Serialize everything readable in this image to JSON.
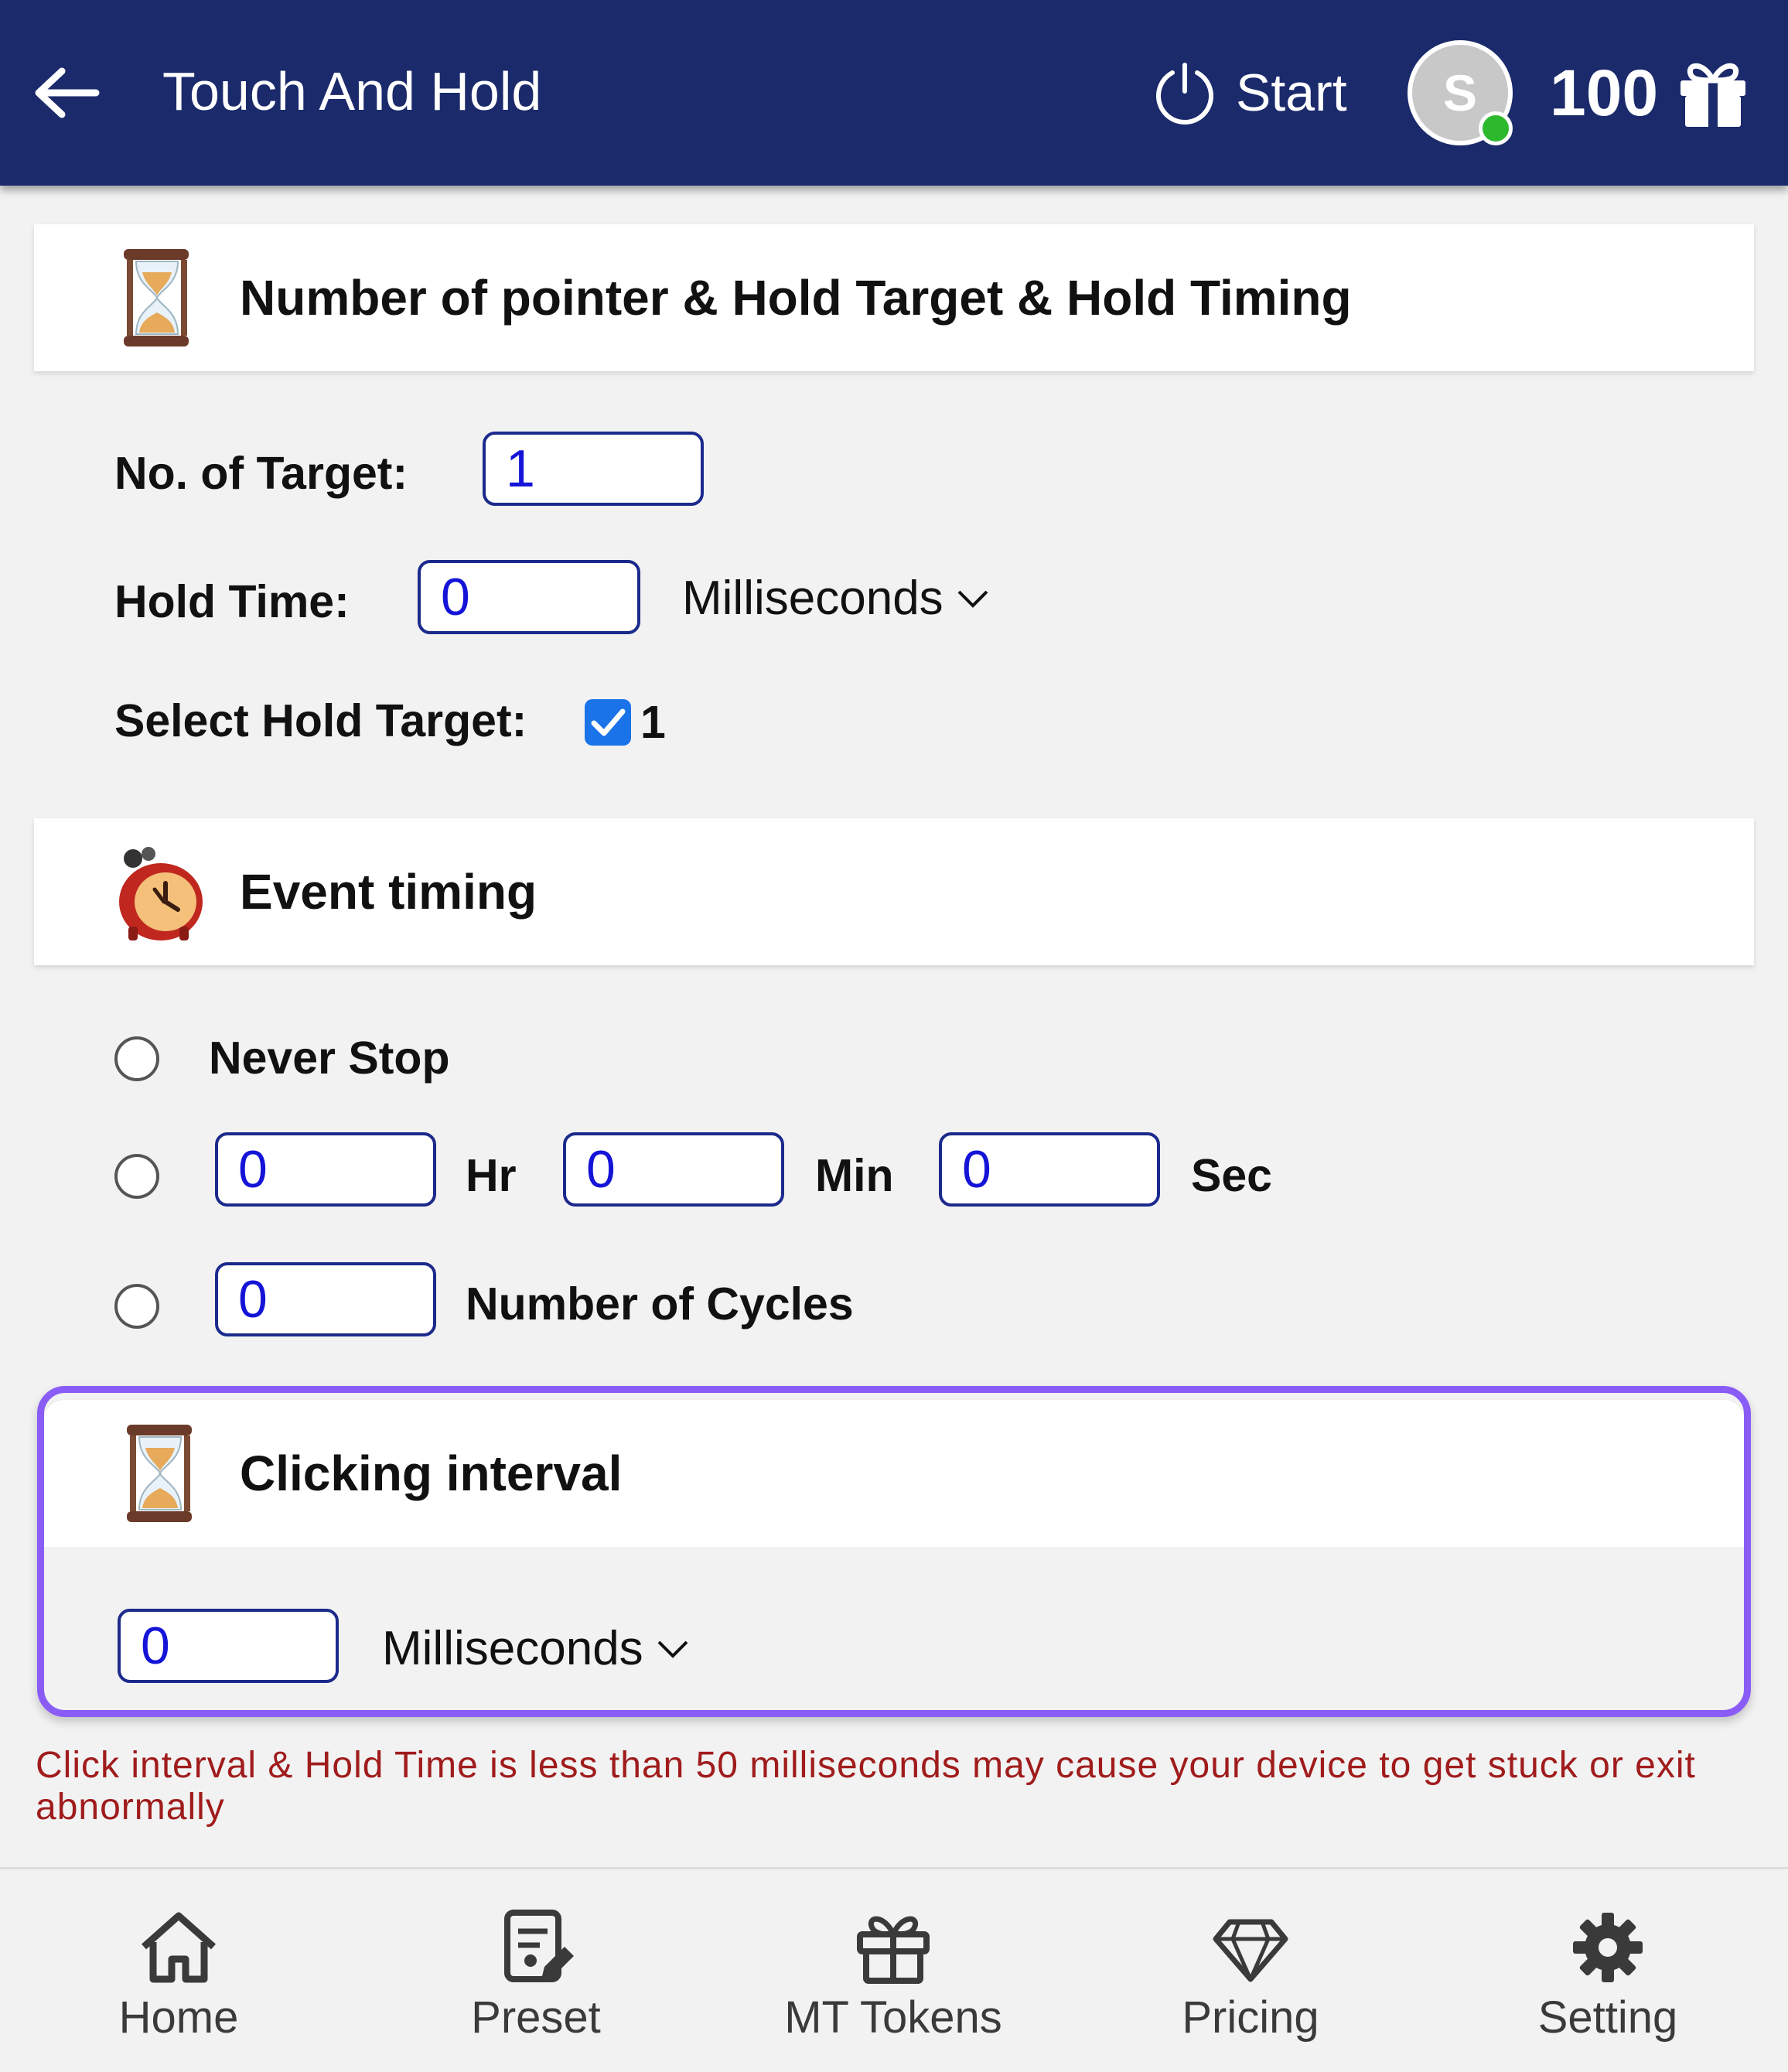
{
  "header": {
    "title": "Touch And Hold",
    "start_label": "Start",
    "avatar_letter": "S",
    "tokens": "100",
    "bg_color": "#1b2a6b"
  },
  "section_pointer": {
    "title": "Number of pointer & Hold Target & Hold Timing",
    "target_label": "No. of Target:",
    "target_value": "1",
    "hold_label": "Hold Time:",
    "hold_value": "0",
    "hold_unit": "Milliseconds",
    "select_label": "Select Hold Target:",
    "select_item": "1"
  },
  "section_event": {
    "title": "Event timing",
    "never_stop": "Never Stop",
    "hr_value": "0",
    "hr_label": "Hr",
    "min_value": "0",
    "min_label": "Min",
    "sec_value": "0",
    "sec_label": "Sec",
    "cycles_value": "0",
    "cycles_label": "Number of Cycles"
  },
  "section_interval": {
    "title": "Clicking interval",
    "value": "0",
    "unit": "Milliseconds",
    "highlight_color": "#8a5cf6"
  },
  "warning": "Click interval & Hold Time is less than 50 milliseconds may cause your device to get stuck or exit abnormally",
  "nav": {
    "items": [
      {
        "label": "Home",
        "icon": "home-icon"
      },
      {
        "label": "Preset",
        "icon": "preset-icon"
      },
      {
        "label": "MT Tokens",
        "icon": "gift-icon"
      },
      {
        "label": "Pricing",
        "icon": "diamond-icon"
      },
      {
        "label": "Setting",
        "icon": "gear-icon"
      }
    ]
  }
}
